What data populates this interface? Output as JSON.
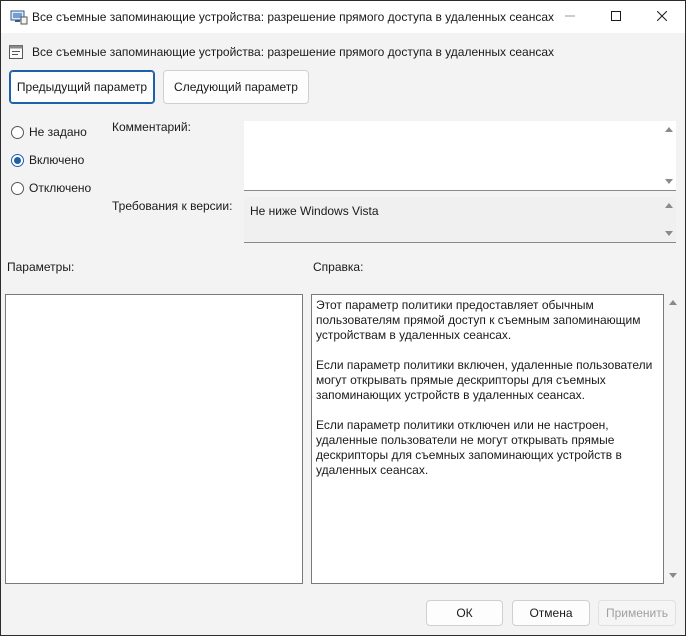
{
  "window": {
    "title": "Все съемные запоминающие устройства: разрешение прямого доступа в удаленных сеансах",
    "controls": {
      "minimize": "minimize",
      "maximize": "maximize",
      "close": "close"
    }
  },
  "header": {
    "policy_title": "Все съемные запоминающие устройства: разрешение прямого доступа в удаленных сеансах"
  },
  "nav": {
    "prev_label": "Предыдущий параметр",
    "next_label": "Следующий параметр"
  },
  "state": {
    "options": [
      {
        "label": "Не задано",
        "checked": false
      },
      {
        "label": "Включено",
        "checked": true
      },
      {
        "label": "Отключено",
        "checked": false
      }
    ]
  },
  "comment": {
    "label": "Комментарий:",
    "value": ""
  },
  "version": {
    "label": "Требования к версии:",
    "value": "Не ниже Windows Vista"
  },
  "sections": {
    "params_label": "Параметры:",
    "help_label": "Справка:"
  },
  "help": {
    "paragraphs": [
      "Этот параметр политики предоставляет обычным пользователям прямой доступ к съемным запоминающим устройствам в удаленных сеансах.",
      "Если параметр политики включен, удаленные пользователи могут открывать прямые дескрипторы для съемных запоминающих устройств в удаленных сеансах.",
      "Если параметр политики отключен или не настроен, удаленные пользователи не могут открывать прямые дескрипторы для съемных запоминающих устройств в удаленных сеансах."
    ]
  },
  "footer": {
    "ok_label": "ОК",
    "cancel_label": "Отмена",
    "apply_label": "Применить"
  },
  "colors": {
    "accent": "#1f5fa8",
    "disabled_text": "#a0a0a0",
    "window_bg": "#f3f3f3"
  }
}
